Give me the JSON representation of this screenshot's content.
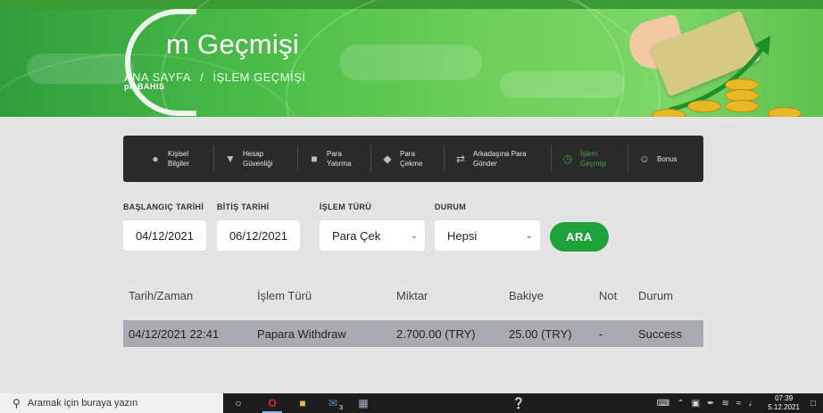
{
  "banner": {
    "logo_word": "pinBAHIS",
    "title": "m Geçmişi",
    "breadcrumb": {
      "home": "ANA SAYFA",
      "separator": "/",
      "current": "İŞLEM GEÇMİŞİ"
    }
  },
  "nav": {
    "items": [
      {
        "label": "Kişisel\nBilgiler",
        "icon": "person-icon"
      },
      {
        "label": "Hesap\nGüvenliği",
        "icon": "shield-icon"
      },
      {
        "label": "Para\nYatırma",
        "icon": "wallet-icon"
      },
      {
        "label": "Para\nÇekme",
        "icon": "cash-icon"
      },
      {
        "label": "Arkadaşına Para\nGönder",
        "icon": "transfer-icon"
      },
      {
        "label": "İşlem\nGeçmişi",
        "icon": "history-icon",
        "active": true
      },
      {
        "label": "Bonus",
        "icon": "smile-icon"
      }
    ]
  },
  "filters": {
    "start_label": "BAŞLANGIÇ TARİHİ",
    "start_value": "04/12/2021",
    "end_label": "BİTİŞ TARİHİ",
    "end_value": "06/12/2021",
    "type_label": "İŞLEM TÜRÜ",
    "type_value": "Para Çek",
    "status_label": "DURUM",
    "status_value": "Hepsi",
    "search_label": "ARA"
  },
  "table": {
    "headers": [
      "Tarih/Zaman",
      "İşlem Türü",
      "Miktar",
      "Bakiye",
      "Not",
      "Durum"
    ],
    "rows": [
      [
        "04/12/2021 22:41",
        "Papara Withdraw",
        "2.700.00 (TRY)",
        "25.00 (TRY)",
        "-",
        "Success"
      ]
    ]
  },
  "taskbar": {
    "search_placeholder": "Aramak için buraya yazın",
    "clock_time": "07:39",
    "clock_date": "5.12.2021",
    "mail_badge": "3"
  },
  "colors": {
    "accent": "#1ea33c",
    "active_nav": "#3ea84a",
    "row_bg": "#a9abb1"
  }
}
